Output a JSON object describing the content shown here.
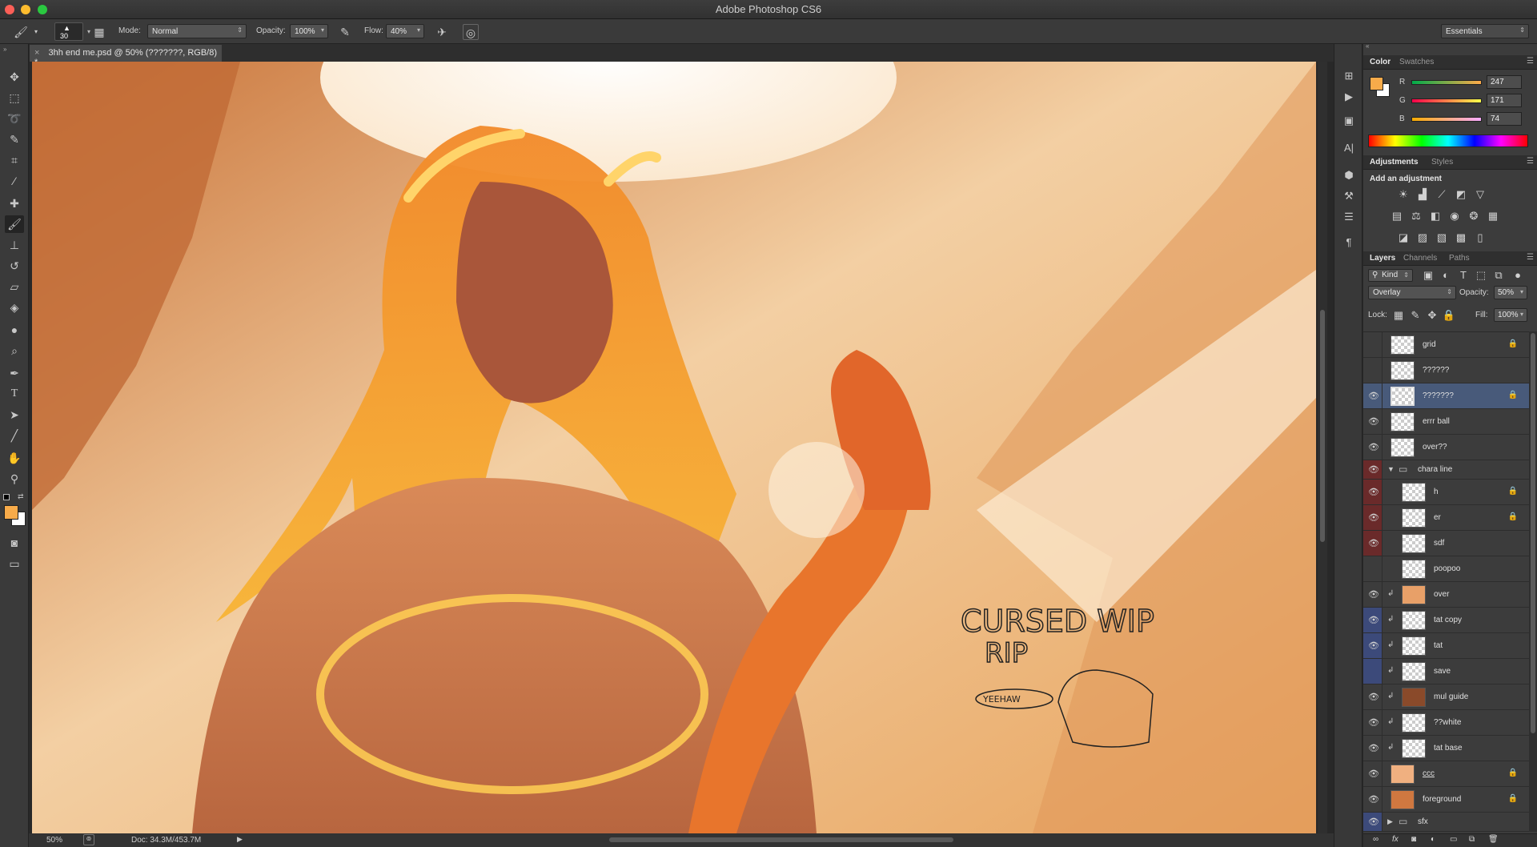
{
  "app": {
    "title": "Adobe Photoshop CS6"
  },
  "options_bar": {
    "brush_size": "30",
    "mode_label": "Mode:",
    "mode_value": "Normal",
    "opacity_label": "Opacity:",
    "opacity_value": "100%",
    "flow_label": "Flow:",
    "flow_value": "40%",
    "workspace": "Essentials"
  },
  "document": {
    "tab_title": "3hh end me.psd @ 50% (???????, RGB/8) *",
    "zoom": "50%",
    "doc_info": "Doc: 34.3M/453.7M"
  },
  "canvas": {
    "annotation_line1": "CURSED WIP",
    "annotation_line2": "RIP",
    "annotation_bubble": "YEEHAW"
  },
  "color_panel": {
    "tabs": [
      "Color",
      "Swatches"
    ],
    "foreground": "#f7ab4a",
    "background": "#ffffff",
    "r_label": "R",
    "r_value": "247",
    "g_label": "G",
    "g_value": "171",
    "b_label": "B",
    "b_value": "74"
  },
  "adjustments_panel": {
    "tabs": [
      "Adjustments",
      "Styles"
    ],
    "heading": "Add an adjustment"
  },
  "layers_panel": {
    "tabs": [
      "Layers",
      "Channels",
      "Paths"
    ],
    "filter_kind": "Kind",
    "blend_mode": "Overlay",
    "opacity_label": "Opacity:",
    "opacity_value": "50%",
    "lock_label": "Lock:",
    "fill_label": "Fill:",
    "fill_value": "100%",
    "layers": [
      {
        "name": "grid"
      },
      {
        "name": "??????"
      },
      {
        "name": "???????"
      },
      {
        "name": "errr ball"
      },
      {
        "name": "over??"
      },
      {
        "name": "chara line"
      },
      {
        "name": "h"
      },
      {
        "name": "er"
      },
      {
        "name": "sdf"
      },
      {
        "name": "poopoo"
      },
      {
        "name": "over"
      },
      {
        "name": "tat copy"
      },
      {
        "name": "tat"
      },
      {
        "name": "save"
      },
      {
        "name": "mul guide"
      },
      {
        "name": "??white"
      },
      {
        "name": "tat base"
      },
      {
        "name": "ccc"
      },
      {
        "name": "foreground"
      },
      {
        "name": "sfx"
      }
    ]
  }
}
